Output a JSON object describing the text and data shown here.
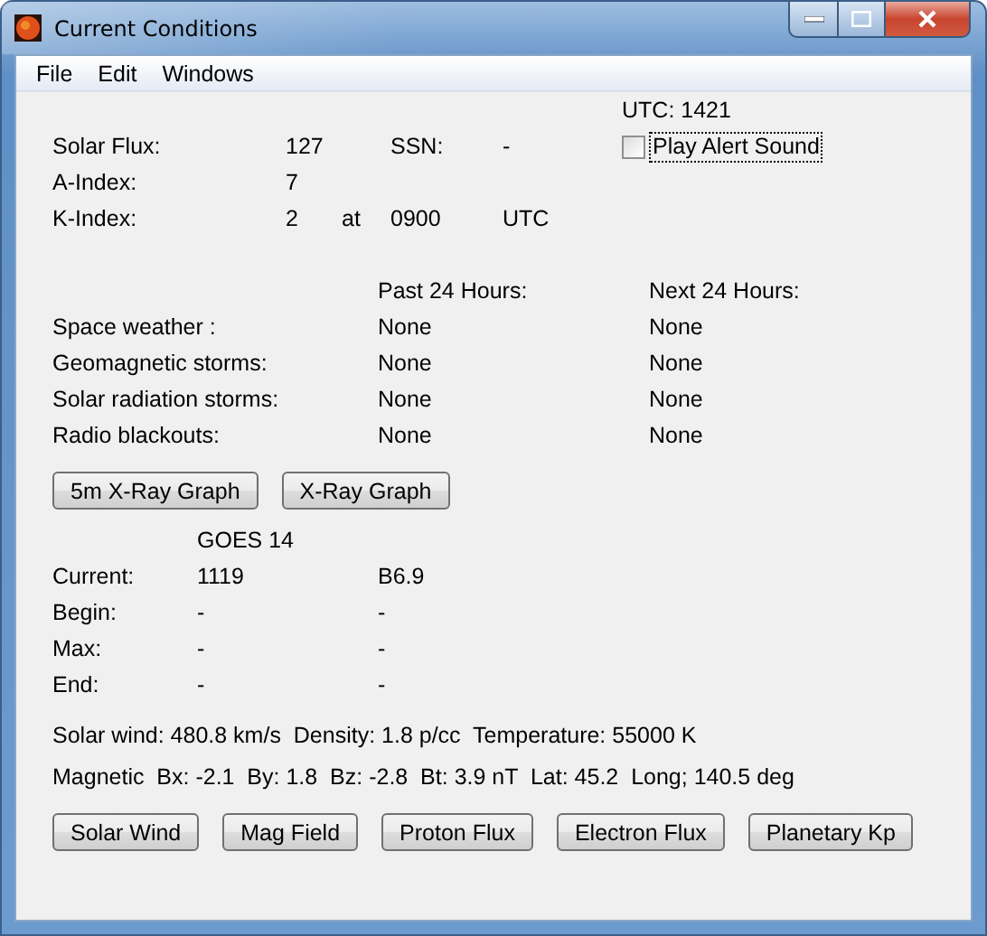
{
  "window": {
    "title": "Current Conditions"
  },
  "menu": [
    "File",
    "Edit",
    "Windows"
  ],
  "utc": "UTC: 1421",
  "alert_sound": {
    "label": "Play Alert Sound",
    "checked": false
  },
  "solar_flux": {
    "label": "Solar Flux:",
    "value": "127"
  },
  "ssn": {
    "label": "SSN:",
    "value": "-"
  },
  "a_index": {
    "label": "A-Index:",
    "value": "7"
  },
  "k_index": {
    "label": "K-Index:",
    "value": "2",
    "at": "at",
    "time": "0900",
    "zone": "UTC"
  },
  "forecast": {
    "headers": [
      "Past 24 Hours:",
      "Next 24 Hours:"
    ],
    "rows": [
      {
        "label": "Space weather :",
        "past": "None",
        "next": "None"
      },
      {
        "label": "Geomagnetic storms:",
        "past": "None",
        "next": "None"
      },
      {
        "label": "Solar radiation storms:",
        "past": "None",
        "next": "None"
      },
      {
        "label": "Radio blackouts:",
        "past": "None",
        "next": "None"
      }
    ]
  },
  "graph_buttons": [
    "5m X-Ray Graph",
    "X-Ray Graph"
  ],
  "goes": {
    "header": "GOES 14",
    "rows": [
      {
        "label": "Current:",
        "column_2": "1119",
        "column_3": "B6.9"
      },
      {
        "label": "Begin:",
        "column_2": "-",
        "column_3": "-"
      },
      {
        "label": "Max:",
        "column_2": "-",
        "column_3": "-"
      },
      {
        "label": "End:",
        "column_2": "-",
        "column_3": "-"
      }
    ]
  },
  "solar_wind": "Solar wind: 480.8 km/s  Density: 1.8 p/cc  Temperature: 55000 K",
  "magnetic": "Magnetic  Bx: -2.1  By: 1.8  Bz: -2.8  Bt: 3.9 nT  Lat: 45.2  Long; 140.5 deg",
  "bottom_buttons": [
    "Solar Wind",
    "Mag Field",
    "Proton Flux",
    "Electron Flux",
    "Planetary Kp"
  ]
}
